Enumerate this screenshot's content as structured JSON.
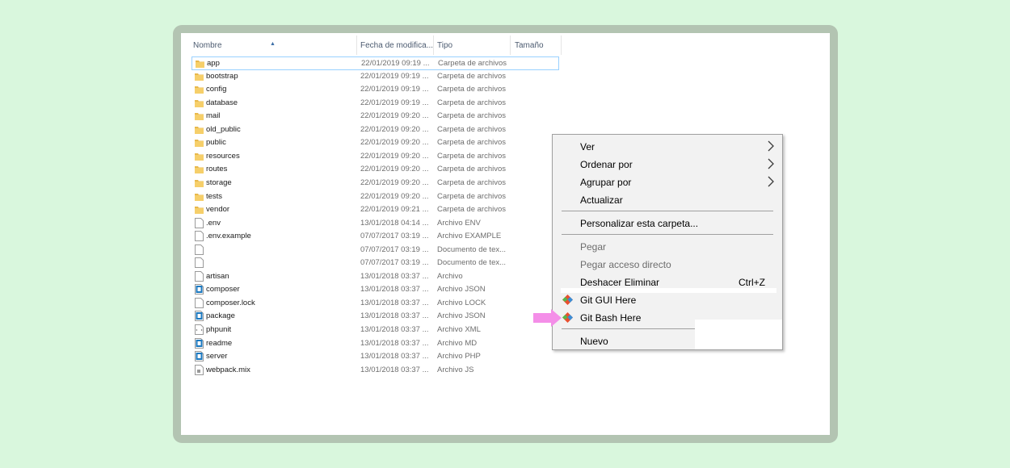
{
  "columns": {
    "name": "Nombre",
    "date": "Fecha de modifica...",
    "type": "Tipo",
    "size": "Tamaño"
  },
  "files": [
    {
      "name": "app",
      "date": "22/01/2019 09:19 ...",
      "type": "Carpeta de archivos",
      "icon": "folder-icon",
      "selected": true
    },
    {
      "name": "bootstrap",
      "date": "22/01/2019 09:19 ...",
      "type": "Carpeta de archivos",
      "icon": "folder-icon"
    },
    {
      "name": "config",
      "date": "22/01/2019 09:19 ...",
      "type": "Carpeta de archivos",
      "icon": "folder-icon"
    },
    {
      "name": "database",
      "date": "22/01/2019 09:19 ...",
      "type": "Carpeta de archivos",
      "icon": "folder-icon"
    },
    {
      "name": "mail",
      "date": "22/01/2019 09:20 ...",
      "type": "Carpeta de archivos",
      "icon": "folder-icon"
    },
    {
      "name": "old_public",
      "date": "22/01/2019 09:20 ...",
      "type": "Carpeta de archivos",
      "icon": "folder-icon"
    },
    {
      "name": "public",
      "date": "22/01/2019 09:20 ...",
      "type": "Carpeta de archivos",
      "icon": "folder-icon"
    },
    {
      "name": "resources",
      "date": "22/01/2019 09:20 ...",
      "type": "Carpeta de archivos",
      "icon": "folder-icon"
    },
    {
      "name": "routes",
      "date": "22/01/2019 09:20 ...",
      "type": "Carpeta de archivos",
      "icon": "folder-icon"
    },
    {
      "name": "storage",
      "date": "22/01/2019 09:20 ...",
      "type": "Carpeta de archivos",
      "icon": "folder-icon"
    },
    {
      "name": "tests",
      "date": "22/01/2019 09:20 ...",
      "type": "Carpeta de archivos",
      "icon": "folder-icon"
    },
    {
      "name": "vendor",
      "date": "22/01/2019 09:21 ...",
      "type": "Carpeta de archivos",
      "icon": "folder-icon"
    },
    {
      "name": ".env",
      "date": "13/01/2018 04:14 ...",
      "type": "Archivo ENV",
      "icon": "file-icon"
    },
    {
      "name": ".env.example",
      "date": "07/07/2017 03:19 ...",
      "type": "Archivo EXAMPLE",
      "icon": "file-icon"
    },
    {
      "name": "",
      "date": "07/07/2017 03:19 ...",
      "type": "Documento de tex...",
      "icon": "file-icon"
    },
    {
      "name": "",
      "date": "07/07/2017 03:19 ...",
      "type": "Documento de tex...",
      "icon": "file-icon"
    },
    {
      "name": "artisan",
      "date": "13/01/2018 03:37 ...",
      "type": "Archivo",
      "icon": "file-icon"
    },
    {
      "name": "composer",
      "date": "13/01/2018 03:37 ...",
      "type": "Archivo JSON",
      "icon": "code-file-icon"
    },
    {
      "name": "composer.lock",
      "date": "13/01/2018 03:37 ...",
      "type": "Archivo LOCK",
      "icon": "file-icon"
    },
    {
      "name": "package",
      "date": "13/01/2018 03:37 ...",
      "type": "Archivo JSON",
      "icon": "code-file-icon"
    },
    {
      "name": "phpunit",
      "date": "13/01/2018 03:37 ...",
      "type": "Archivo XML",
      "icon": "xml-file-icon"
    },
    {
      "name": "readme",
      "date": "13/01/2018 03:37 ...",
      "type": "Archivo MD",
      "icon": "code-file-icon"
    },
    {
      "name": "server",
      "date": "13/01/2018 03:37 ...",
      "type": "Archivo PHP",
      "icon": "code-file-icon"
    },
    {
      "name": "webpack.mix",
      "date": "13/01/2018 03:37 ...",
      "type": "Archivo JS",
      "icon": "js-file-icon"
    }
  ],
  "context_menu": {
    "items": [
      {
        "label": "Ver",
        "submenu": true
      },
      {
        "label": "Ordenar por",
        "submenu": true
      },
      {
        "label": "Agrupar por",
        "submenu": true
      },
      {
        "label": "Actualizar"
      },
      {
        "separator": true
      },
      {
        "label": "Personalizar esta carpeta..."
      },
      {
        "separator": true
      },
      {
        "label": "Pegar",
        "disabled": true
      },
      {
        "label": "Pegar acceso directo",
        "disabled": true
      },
      {
        "label": "Deshacer Eliminar",
        "shortcut": "Ctrl+Z"
      },
      {
        "label": "Git GUI Here",
        "icon": "git-icon"
      },
      {
        "label": "Git Bash Here",
        "icon": "git-icon"
      },
      {
        "separator": true
      },
      {
        "label": "Nuevo"
      }
    ]
  },
  "colors": {
    "background": "#d9f7dd",
    "frame": "#b3c4b2",
    "selection_border": "#99d1ff",
    "folder": "#e8b84b",
    "pointer_arrow": "#f48ee8"
  },
  "annotation": {
    "icon": "pointer-arrow-icon"
  }
}
